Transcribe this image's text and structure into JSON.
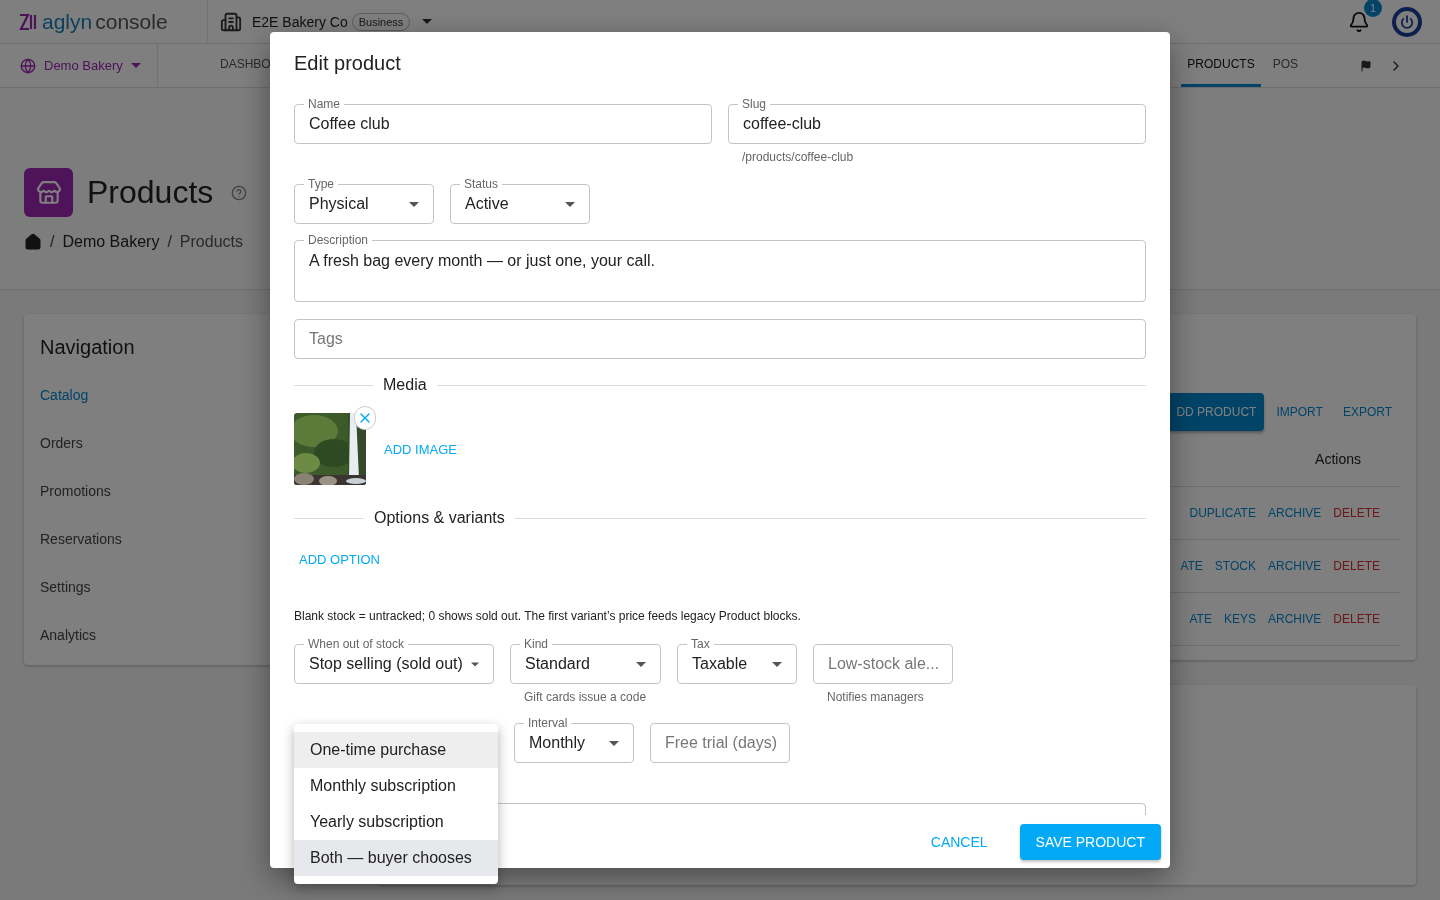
{
  "topbar": {
    "logo_primary": "aglyn",
    "logo_secondary": "console",
    "org_name": "E2E Bakery Co",
    "org_plan": "Business",
    "notification_count": "1"
  },
  "nav_bar": {
    "site": "Demo Bakery",
    "tabs": [
      {
        "label": "DASHBO",
        "selected": false
      },
      {
        "label": "PRODUCTS",
        "selected": true
      },
      {
        "label": "POS",
        "selected": false
      }
    ]
  },
  "page": {
    "title": "Products",
    "breadcrumb": [
      {
        "separator": "/",
        "label": "Demo Bakery"
      },
      {
        "separator": "/",
        "label": "Products"
      }
    ]
  },
  "navigation": {
    "title": "Navigation",
    "items": [
      {
        "label": "Catalog",
        "selected": true
      },
      {
        "label": "Orders",
        "selected": false
      },
      {
        "label": "Promotions",
        "selected": false
      },
      {
        "label": "Reservations",
        "selected": false
      },
      {
        "label": "Settings",
        "selected": false
      },
      {
        "label": "Analytics",
        "selected": false
      }
    ]
  },
  "products_panel": {
    "toolbar": [
      {
        "label": "DD PRODUCT",
        "kind": "contained"
      },
      {
        "label": "IMPORT",
        "kind": "text"
      },
      {
        "label": "EXPORT",
        "kind": "text"
      }
    ],
    "actions_header": "Actions",
    "rows": [
      {
        "actions": [
          {
            "label": "DUPLICATE",
            "kind": "default"
          },
          {
            "label": "ARCHIVE",
            "kind": "default"
          },
          {
            "label": "DELETE",
            "kind": "danger"
          }
        ]
      },
      {
        "actions": [
          {
            "label": "ATE",
            "kind": "default"
          },
          {
            "label": "STOCK",
            "kind": "default"
          },
          {
            "label": "ARCHIVE",
            "kind": "default"
          },
          {
            "label": "DELETE",
            "kind": "danger"
          }
        ]
      },
      {
        "actions": [
          {
            "label": "ATE",
            "kind": "default"
          },
          {
            "label": "KEYS",
            "kind": "default"
          },
          {
            "label": "ARCHIVE",
            "kind": "default"
          },
          {
            "label": "DELETE",
            "kind": "danger"
          }
        ]
      }
    ]
  },
  "dialog": {
    "title": "Edit product",
    "name": {
      "label": "Name",
      "value": "Coffee club"
    },
    "slug": {
      "label": "Slug",
      "value": "coffee-club",
      "helper": "/products/coffee-club"
    },
    "type": {
      "label": "Type",
      "value": "Physical"
    },
    "status": {
      "label": "Status",
      "value": "Active"
    },
    "description": {
      "label": "Description",
      "value": "A fresh bag every month — or just one, your call."
    },
    "tags": {
      "placeholder": "Tags"
    },
    "media": {
      "heading": "Media",
      "add_label": "ADD IMAGE"
    },
    "options": {
      "heading": "Options & variants",
      "add_label": "ADD OPTION"
    },
    "note": "Blank stock = untracked; 0 shows sold out. The first variant’s price feeds legacy Product blocks.",
    "stock_row": [
      {
        "kind": "select",
        "label": "When out of stock",
        "value": "Stop selling (sold out)"
      },
      {
        "kind": "select",
        "label": "Kind",
        "value": "Standard",
        "helper": "Gift cards issue a code"
      },
      {
        "kind": "select",
        "label": "Tax",
        "value": "Taxable"
      },
      {
        "kind": "input",
        "placeholder": "Low-stock ale...",
        "helper": "Notifies managers"
      }
    ],
    "billing_row": [
      {
        "kind": "select",
        "label": "Interval",
        "value": "Monthly"
      },
      {
        "kind": "input",
        "placeholder": "Free trial (days)"
      }
    ],
    "actions": [
      {
        "label": "CANCEL",
        "kind": "text"
      },
      {
        "label": "SAVE PRODUCT",
        "kind": "contained"
      }
    ]
  },
  "billing_menu": {
    "options": [
      {
        "label": "One-time purchase",
        "selected": true,
        "focused": false
      },
      {
        "label": "Monthly subscription",
        "selected": false,
        "focused": false
      },
      {
        "label": "Yearly subscription",
        "selected": false,
        "focused": false
      },
      {
        "label": "Both — buyer chooses",
        "selected": false,
        "focused": true
      }
    ]
  }
}
